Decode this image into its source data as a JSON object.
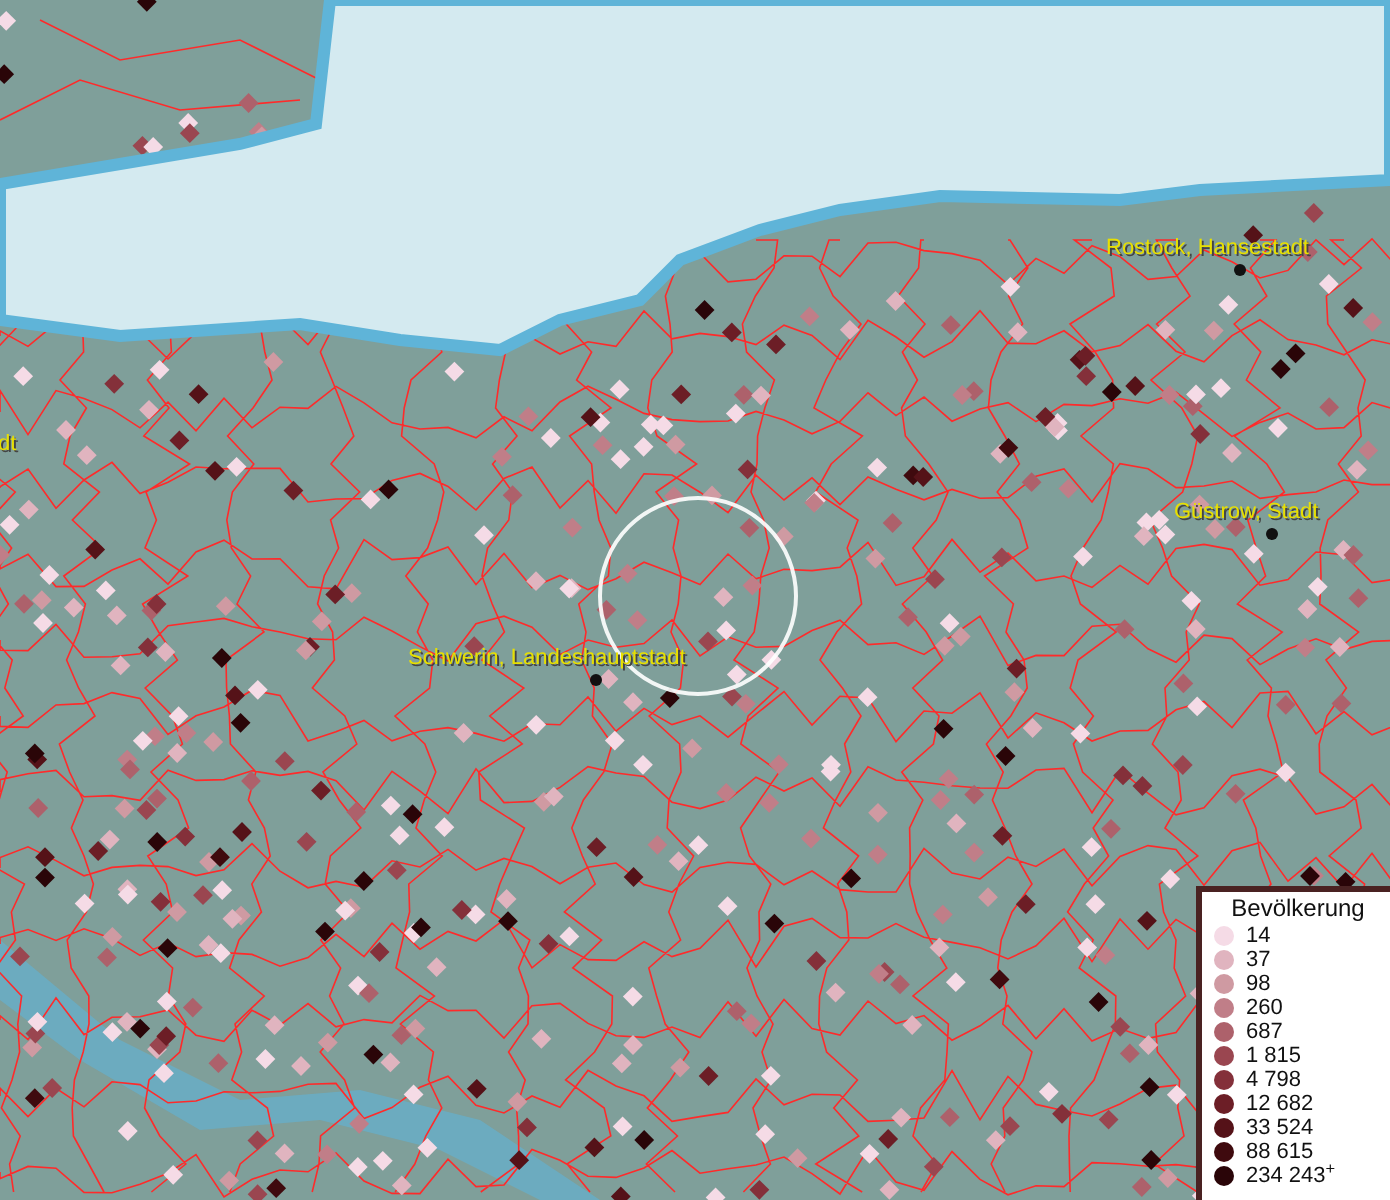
{
  "map": {
    "places": [
      {
        "name": "Rostock, Hansestadt",
        "kind": "city"
      },
      {
        "name": "Güstrow, Stadt",
        "kind": "city"
      },
      {
        "name": "Schwerin, Landeshauptstadt",
        "kind": "city"
      },
      {
        "name": "dt",
        "kind": "edge"
      }
    ]
  },
  "legend": {
    "title": "Bevölkerung",
    "items": [
      {
        "label": "14",
        "color": "#f5dbe6"
      },
      {
        "label": "37",
        "color": "#e0b4bf"
      },
      {
        "label": "98",
        "color": "#cf9aa2"
      },
      {
        "label": "260",
        "color": "#c07e88"
      },
      {
        "label": "687",
        "color": "#ad616b"
      },
      {
        "label": "1 815",
        "color": "#9a4650"
      },
      {
        "label": "4 798",
        "color": "#84303a"
      },
      {
        "label": "12 682",
        "color": "#6c1e26"
      },
      {
        "label": "33 524",
        "color": "#551218"
      },
      {
        "label": "88 615",
        "color": "#3f0a0e"
      },
      {
        "label": "234 243$^{+}$",
        "color": "#2a0508"
      }
    ]
  }
}
